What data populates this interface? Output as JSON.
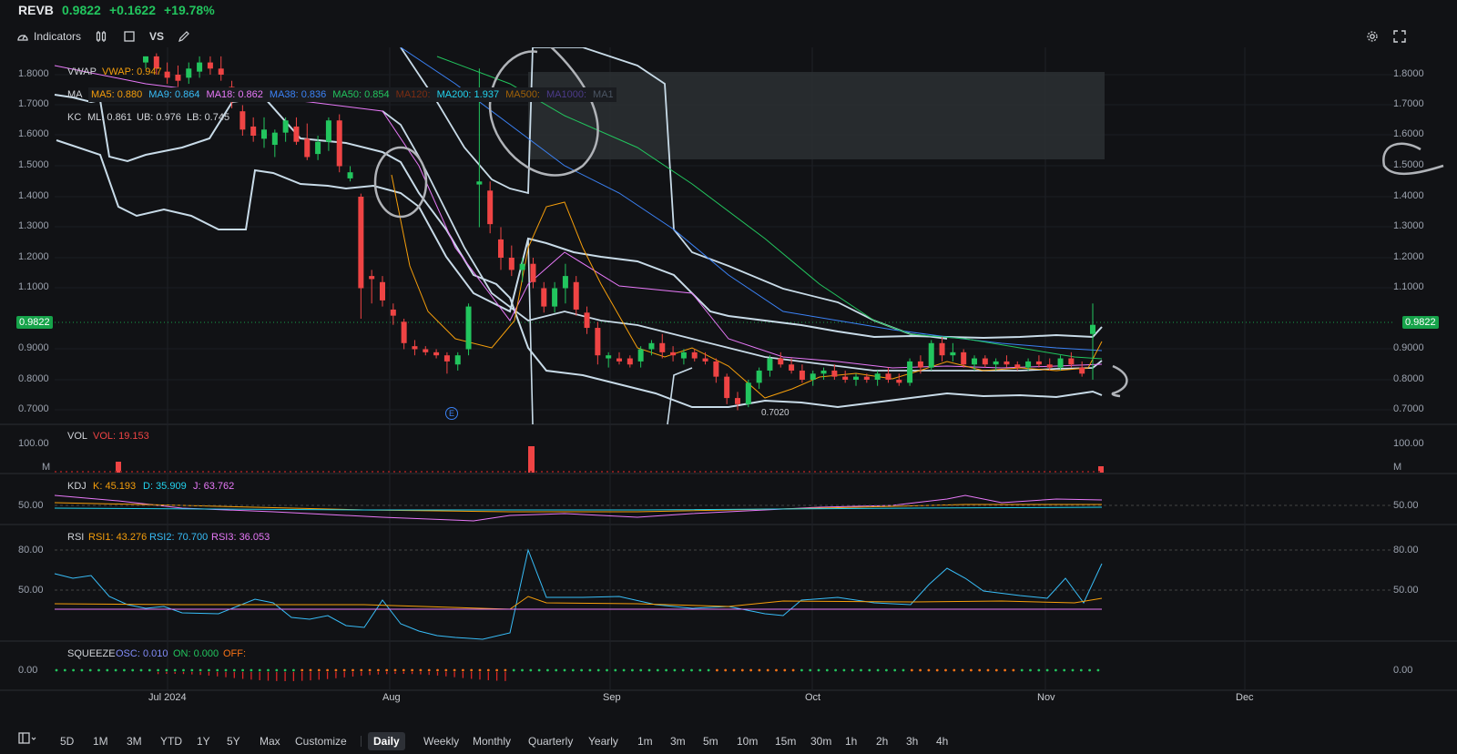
{
  "header": {
    "symbol": "REVB",
    "price": "0.9822",
    "change": "+0.1622",
    "change_pct": "+19.78%"
  },
  "toolbar": {
    "indicators_label": "Indicators",
    "vs_label": "VS"
  },
  "overlays": {
    "vwap": {
      "name": "VWAP",
      "value": "VWAP: 0.947"
    },
    "ma": {
      "name": "MA",
      "items": [
        {
          "label": "MA5: 0.880",
          "color": "#f59e0b"
        },
        {
          "label": "MA9: 0.864",
          "color": "#38bdf8"
        },
        {
          "label": "MA18: 0.862",
          "color": "#e879f9"
        },
        {
          "label": "MA38: 0.836",
          "color": "#3b82f6"
        },
        {
          "label": "MA50: 0.854",
          "color": "#22c55e"
        },
        {
          "label": "MA120:",
          "color": "#7c2d12"
        },
        {
          "label": "MA200: 1.937",
          "color": "#22d3ee"
        },
        {
          "label": "MA500:",
          "color": "#a16207"
        },
        {
          "label": "MA1000:",
          "color": "#4c3b8a"
        },
        {
          "label": "MA1",
          "color": "#4b5563"
        }
      ]
    },
    "kc": {
      "name": "KC",
      "ml": "ML: 0.861",
      "ub": "UB: 0.976",
      "lb": "LB: 0.745"
    }
  },
  "price_axis_ticks": [
    "1.8000",
    "1.7000",
    "1.6000",
    "1.5000",
    "1.4000",
    "1.3000",
    "1.2000",
    "1.1000",
    "0.9822",
    "0.9000",
    "0.8000",
    "0.7000"
  ],
  "price_badge": "0.9822",
  "low_marker": "0.7020",
  "earnings_marker": "E",
  "volume": {
    "name": "VOL",
    "value": "VOL: 19.153",
    "ticks": [
      "100.00",
      "M"
    ]
  },
  "kdj": {
    "name": "KDJ",
    "k": "K: 45.193",
    "d": "D: 35.909",
    "j": "J: 63.762",
    "tick": "50.00"
  },
  "rsi": {
    "name": "RSI",
    "r1": "RSI1: 43.276",
    "r2": "RSI2: 70.700",
    "r3": "RSI3: 36.053",
    "ticks": [
      "80.00",
      "50.00"
    ]
  },
  "squeeze": {
    "name": "SQUEEZE",
    "osc": "OSC: 0.010",
    "on": "ON: 0.000",
    "off": "OFF:",
    "tick": "0.00"
  },
  "x_axis": [
    "Jul 2024",
    "Aug",
    "Sep",
    "Oct",
    "Nov",
    "Dec"
  ],
  "timeframes": {
    "ranges": [
      "5D",
      "1M",
      "3M",
      "YTD",
      "1Y",
      "5Y",
      "Max",
      "Customize"
    ],
    "intervals": [
      "Daily",
      "Weekly",
      "Monthly",
      "Quarterly",
      "Yearly",
      "1m",
      "3m",
      "5m",
      "10m",
      "15m",
      "30m",
      "1h",
      "2h",
      "3h",
      "4h"
    ],
    "active": "Daily"
  },
  "colors": {
    "up": "#22c55e",
    "down": "#ef4444",
    "kc": "#c8dbe8"
  },
  "chart_data": {
    "type": "candlestick",
    "ylim": [
      0.68,
      1.85
    ],
    "candles": [
      {
        "o": 1.84,
        "h": 1.86,
        "l": 1.82,
        "c": 1.86
      },
      {
        "o": 1.86,
        "h": 1.87,
        "l": 1.8,
        "c": 1.82
      },
      {
        "o": 1.81,
        "h": 1.84,
        "l": 1.77,
        "c": 1.79
      },
      {
        "o": 1.8,
        "h": 1.83,
        "l": 1.76,
        "c": 1.78
      },
      {
        "o": 1.79,
        "h": 1.84,
        "l": 1.77,
        "c": 1.82
      },
      {
        "o": 1.81,
        "h": 1.86,
        "l": 1.79,
        "c": 1.84
      },
      {
        "o": 1.84,
        "h": 1.86,
        "l": 1.8,
        "c": 1.82
      },
      {
        "o": 1.82,
        "h": 1.86,
        "l": 1.78,
        "c": 1.8
      },
      {
        "o": 1.76,
        "h": 1.78,
        "l": 1.69,
        "c": 1.71
      },
      {
        "o": 1.68,
        "h": 1.7,
        "l": 1.6,
        "c": 1.62
      },
      {
        "o": 1.63,
        "h": 1.66,
        "l": 1.58,
        "c": 1.6
      },
      {
        "o": 1.59,
        "h": 1.66,
        "l": 1.56,
        "c": 1.62
      },
      {
        "o": 1.57,
        "h": 1.62,
        "l": 1.53,
        "c": 1.61
      },
      {
        "o": 1.61,
        "h": 1.66,
        "l": 1.58,
        "c": 1.65
      },
      {
        "o": 1.63,
        "h": 1.66,
        "l": 1.57,
        "c": 1.58
      },
      {
        "o": 1.59,
        "h": 1.64,
        "l": 1.52,
        "c": 1.53
      },
      {
        "o": 1.54,
        "h": 1.6,
        "l": 1.52,
        "c": 1.58
      },
      {
        "o": 1.58,
        "h": 1.66,
        "l": 1.55,
        "c": 1.65
      },
      {
        "o": 1.65,
        "h": 1.67,
        "l": 1.48,
        "c": 1.5
      },
      {
        "o": 1.46,
        "h": 1.5,
        "l": 1.45,
        "c": 1.48
      },
      {
        "o": 1.4,
        "h": 1.41,
        "l": 1.0,
        "c": 1.1
      },
      {
        "o": 1.14,
        "h": 1.16,
        "l": 1.05,
        "c": 1.13
      },
      {
        "o": 1.12,
        "h": 1.14,
        "l": 1.04,
        "c": 1.06
      },
      {
        "o": 1.03,
        "h": 1.05,
        "l": 0.98,
        "c": 1.01
      },
      {
        "o": 0.99,
        "h": 1.0,
        "l": 0.9,
        "c": 0.92
      },
      {
        "o": 0.91,
        "h": 0.93,
        "l": 0.88,
        "c": 0.9
      },
      {
        "o": 0.9,
        "h": 0.91,
        "l": 0.88,
        "c": 0.89
      },
      {
        "o": 0.89,
        "h": 0.9,
        "l": 0.87,
        "c": 0.88
      },
      {
        "o": 0.88,
        "h": 0.89,
        "l": 0.82,
        "c": 0.86
      },
      {
        "o": 0.85,
        "h": 0.89,
        "l": 0.83,
        "c": 0.88
      },
      {
        "o": 0.9,
        "h": 1.05,
        "l": 0.88,
        "c": 1.04
      },
      {
        "o": 1.44,
        "h": 1.82,
        "l": 1.3,
        "c": 1.45
      },
      {
        "o": 1.42,
        "h": 1.45,
        "l": 1.28,
        "c": 1.31
      },
      {
        "o": 1.26,
        "h": 1.3,
        "l": 1.16,
        "c": 1.2
      },
      {
        "o": 1.2,
        "h": 1.24,
        "l": 1.14,
        "c": 1.16
      },
      {
        "o": 1.16,
        "h": 1.2,
        "l": 1.12,
        "c": 1.18
      },
      {
        "o": 1.18,
        "h": 1.2,
        "l": 1.1,
        "c": 1.12
      },
      {
        "o": 1.1,
        "h": 1.12,
        "l": 1.02,
        "c": 1.04
      },
      {
        "o": 1.04,
        "h": 1.12,
        "l": 1.02,
        "c": 1.1
      },
      {
        "o": 1.1,
        "h": 1.18,
        "l": 1.05,
        "c": 1.14
      },
      {
        "o": 1.12,
        "h": 1.14,
        "l": 1.01,
        "c": 1.03
      },
      {
        "o": 1.02,
        "h": 1.04,
        "l": 0.95,
        "c": 0.97
      },
      {
        "o": 0.97,
        "h": 0.99,
        "l": 0.85,
        "c": 0.88
      },
      {
        "o": 0.87,
        "h": 0.89,
        "l": 0.84,
        "c": 0.88
      },
      {
        "o": 0.87,
        "h": 0.89,
        "l": 0.85,
        "c": 0.86
      },
      {
        "o": 0.87,
        "h": 0.88,
        "l": 0.84,
        "c": 0.85
      },
      {
        "o": 0.86,
        "h": 0.91,
        "l": 0.84,
        "c": 0.9
      },
      {
        "o": 0.9,
        "h": 0.93,
        "l": 0.88,
        "c": 0.92
      },
      {
        "o": 0.92,
        "h": 0.95,
        "l": 0.87,
        "c": 0.89
      },
      {
        "o": 0.89,
        "h": 0.91,
        "l": 0.86,
        "c": 0.88
      },
      {
        "o": 0.87,
        "h": 0.9,
        "l": 0.85,
        "c": 0.89
      },
      {
        "o": 0.89,
        "h": 0.9,
        "l": 0.86,
        "c": 0.87
      },
      {
        "o": 0.87,
        "h": 0.89,
        "l": 0.85,
        "c": 0.86
      },
      {
        "o": 0.86,
        "h": 0.87,
        "l": 0.79,
        "c": 0.81
      },
      {
        "o": 0.81,
        "h": 0.82,
        "l": 0.72,
        "c": 0.74
      },
      {
        "o": 0.74,
        "h": 0.76,
        "l": 0.7,
        "c": 0.72
      },
      {
        "o": 0.72,
        "h": 0.8,
        "l": 0.71,
        "c": 0.79
      },
      {
        "o": 0.79,
        "h": 0.84,
        "l": 0.77,
        "c": 0.83
      },
      {
        "o": 0.83,
        "h": 0.88,
        "l": 0.81,
        "c": 0.87
      },
      {
        "o": 0.87,
        "h": 0.89,
        "l": 0.84,
        "c": 0.85
      },
      {
        "o": 0.85,
        "h": 0.87,
        "l": 0.82,
        "c": 0.83
      },
      {
        "o": 0.83,
        "h": 0.85,
        "l": 0.79,
        "c": 0.8
      },
      {
        "o": 0.8,
        "h": 0.83,
        "l": 0.78,
        "c": 0.82
      },
      {
        "o": 0.82,
        "h": 0.84,
        "l": 0.8,
        "c": 0.83
      },
      {
        "o": 0.83,
        "h": 0.85,
        "l": 0.8,
        "c": 0.81
      },
      {
        "o": 0.81,
        "h": 0.83,
        "l": 0.79,
        "c": 0.8
      },
      {
        "o": 0.8,
        "h": 0.82,
        "l": 0.78,
        "c": 0.81
      },
      {
        "o": 0.81,
        "h": 0.82,
        "l": 0.79,
        "c": 0.8
      },
      {
        "o": 0.8,
        "h": 0.83,
        "l": 0.78,
        "c": 0.82
      },
      {
        "o": 0.82,
        "h": 0.84,
        "l": 0.79,
        "c": 0.8
      },
      {
        "o": 0.8,
        "h": 0.82,
        "l": 0.78,
        "c": 0.79
      },
      {
        "o": 0.79,
        "h": 0.87,
        "l": 0.78,
        "c": 0.86
      },
      {
        "o": 0.86,
        "h": 0.88,
        "l": 0.82,
        "c": 0.84
      },
      {
        "o": 0.84,
        "h": 0.93,
        "l": 0.83,
        "c": 0.92
      },
      {
        "o": 0.92,
        "h": 0.94,
        "l": 0.86,
        "c": 0.88
      },
      {
        "o": 0.88,
        "h": 0.92,
        "l": 0.86,
        "c": 0.89
      },
      {
        "o": 0.89,
        "h": 0.9,
        "l": 0.84,
        "c": 0.85
      },
      {
        "o": 0.85,
        "h": 0.88,
        "l": 0.83,
        "c": 0.87
      },
      {
        "o": 0.87,
        "h": 0.88,
        "l": 0.84,
        "c": 0.85
      },
      {
        "o": 0.85,
        "h": 0.87,
        "l": 0.83,
        "c": 0.86
      },
      {
        "o": 0.86,
        "h": 0.88,
        "l": 0.84,
        "c": 0.85
      },
      {
        "o": 0.85,
        "h": 0.86,
        "l": 0.83,
        "c": 0.84
      },
      {
        "o": 0.84,
        "h": 0.87,
        "l": 0.83,
        "c": 0.86
      },
      {
        "o": 0.86,
        "h": 0.88,
        "l": 0.84,
        "c": 0.85
      },
      {
        "o": 0.85,
        "h": 0.87,
        "l": 0.83,
        "c": 0.84
      },
      {
        "o": 0.84,
        "h": 0.88,
        "l": 0.83,
        "c": 0.87
      },
      {
        "o": 0.87,
        "h": 0.89,
        "l": 0.84,
        "c": 0.85
      },
      {
        "o": 0.84,
        "h": 0.86,
        "l": 0.81,
        "c": 0.82
      },
      {
        "o": 0.95,
        "h": 1.05,
        "l": 0.8,
        "c": 0.98
      }
    ]
  }
}
